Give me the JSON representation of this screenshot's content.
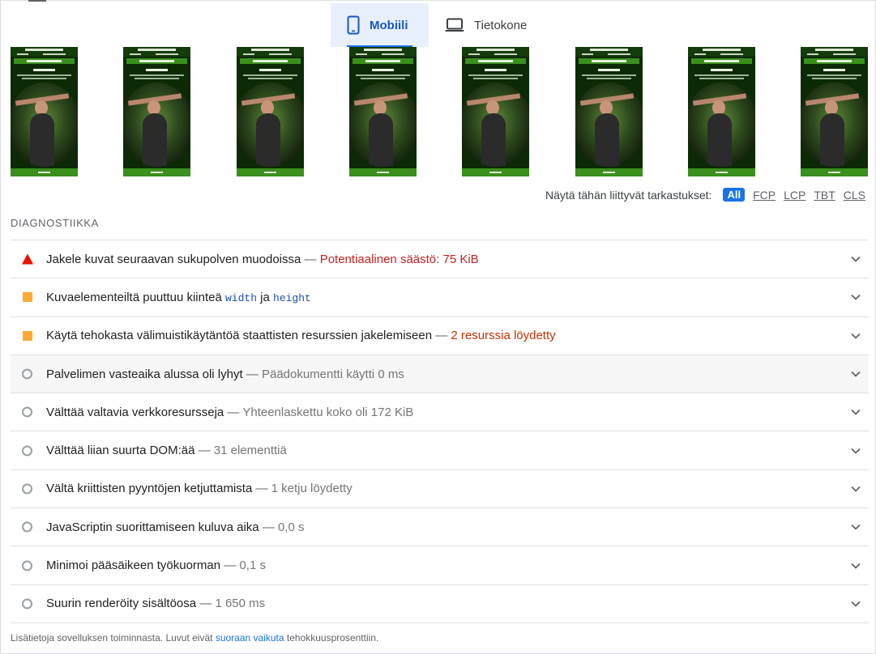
{
  "tabs": {
    "mobile_label": "Mobiili",
    "desktop_label": "Tietokone",
    "active": "mobile"
  },
  "filmstrip": {
    "frame_count": 8
  },
  "filter": {
    "label": "Näytä tähän liittyvät tarkastukset:",
    "chips": [
      "All",
      "FCP",
      "LCP",
      "TBT",
      "CLS"
    ],
    "active": "All"
  },
  "section_title": "DIAGNOSTIIKKA",
  "audits": [
    {
      "icon": "fail-triangle-icon",
      "title": "Jakele kuvat seuraavan sukupolven muodoissa",
      "display": "Potentiaalinen säästö: 75 KiB",
      "status": "fail"
    },
    {
      "icon": "average-square-icon",
      "title_before": "Kuvaelementeiltä puuttuu kiinteä",
      "code1": "width",
      "mid": "ja",
      "code2": "height",
      "display": "",
      "status": "average"
    },
    {
      "icon": "average-square-icon",
      "title": "Käytä tehokasta välimuistikäytäntöä staattisten resurssien jakelemiseen",
      "display": "2 resurssia löydetty",
      "status": "average"
    },
    {
      "icon": "info-circle-icon",
      "title": "Palvelimen vasteaika alussa oli lyhyt",
      "display": "Päädokumentti käytti 0 ms",
      "status": "info"
    },
    {
      "icon": "info-circle-icon",
      "title": "Välttää valtavia verkkoresursseja",
      "display": "Yhteenlaskettu koko oli 172 KiB",
      "status": "info"
    },
    {
      "icon": "info-circle-icon",
      "title": "Välttää liian suurta DOM:ää",
      "display": "31 elementtiä",
      "status": "info"
    },
    {
      "icon": "info-circle-icon",
      "title": "Vältä kriittisten pyyntöjen ketjuttamista",
      "display": "1 ketju löydetty",
      "status": "info"
    },
    {
      "icon": "info-circle-icon",
      "title": "JavaScriptin suorittamiseen kuluva aika",
      "display": "0,0 s",
      "status": "info"
    },
    {
      "icon": "info-circle-icon",
      "title": "Minimoi pääsäikeen työkuorman",
      "display": "0,1 s",
      "status": "info"
    },
    {
      "icon": "info-circle-icon",
      "title": "Suurin renderöity sisältöosa",
      "display": "1 650 ms",
      "status": "info"
    }
  ],
  "footer": {
    "text_before": "Lisätietoja sovelluksen toiminnasta. Luvut eivät",
    "link": "suoraan vaikuta",
    "text_after": "tehokkuusprosenttiin."
  },
  "colors": {
    "accent": "#1a73e8",
    "fail": "#eb0f00",
    "average": "#ffaa33",
    "info": "#9aa0a6"
  }
}
